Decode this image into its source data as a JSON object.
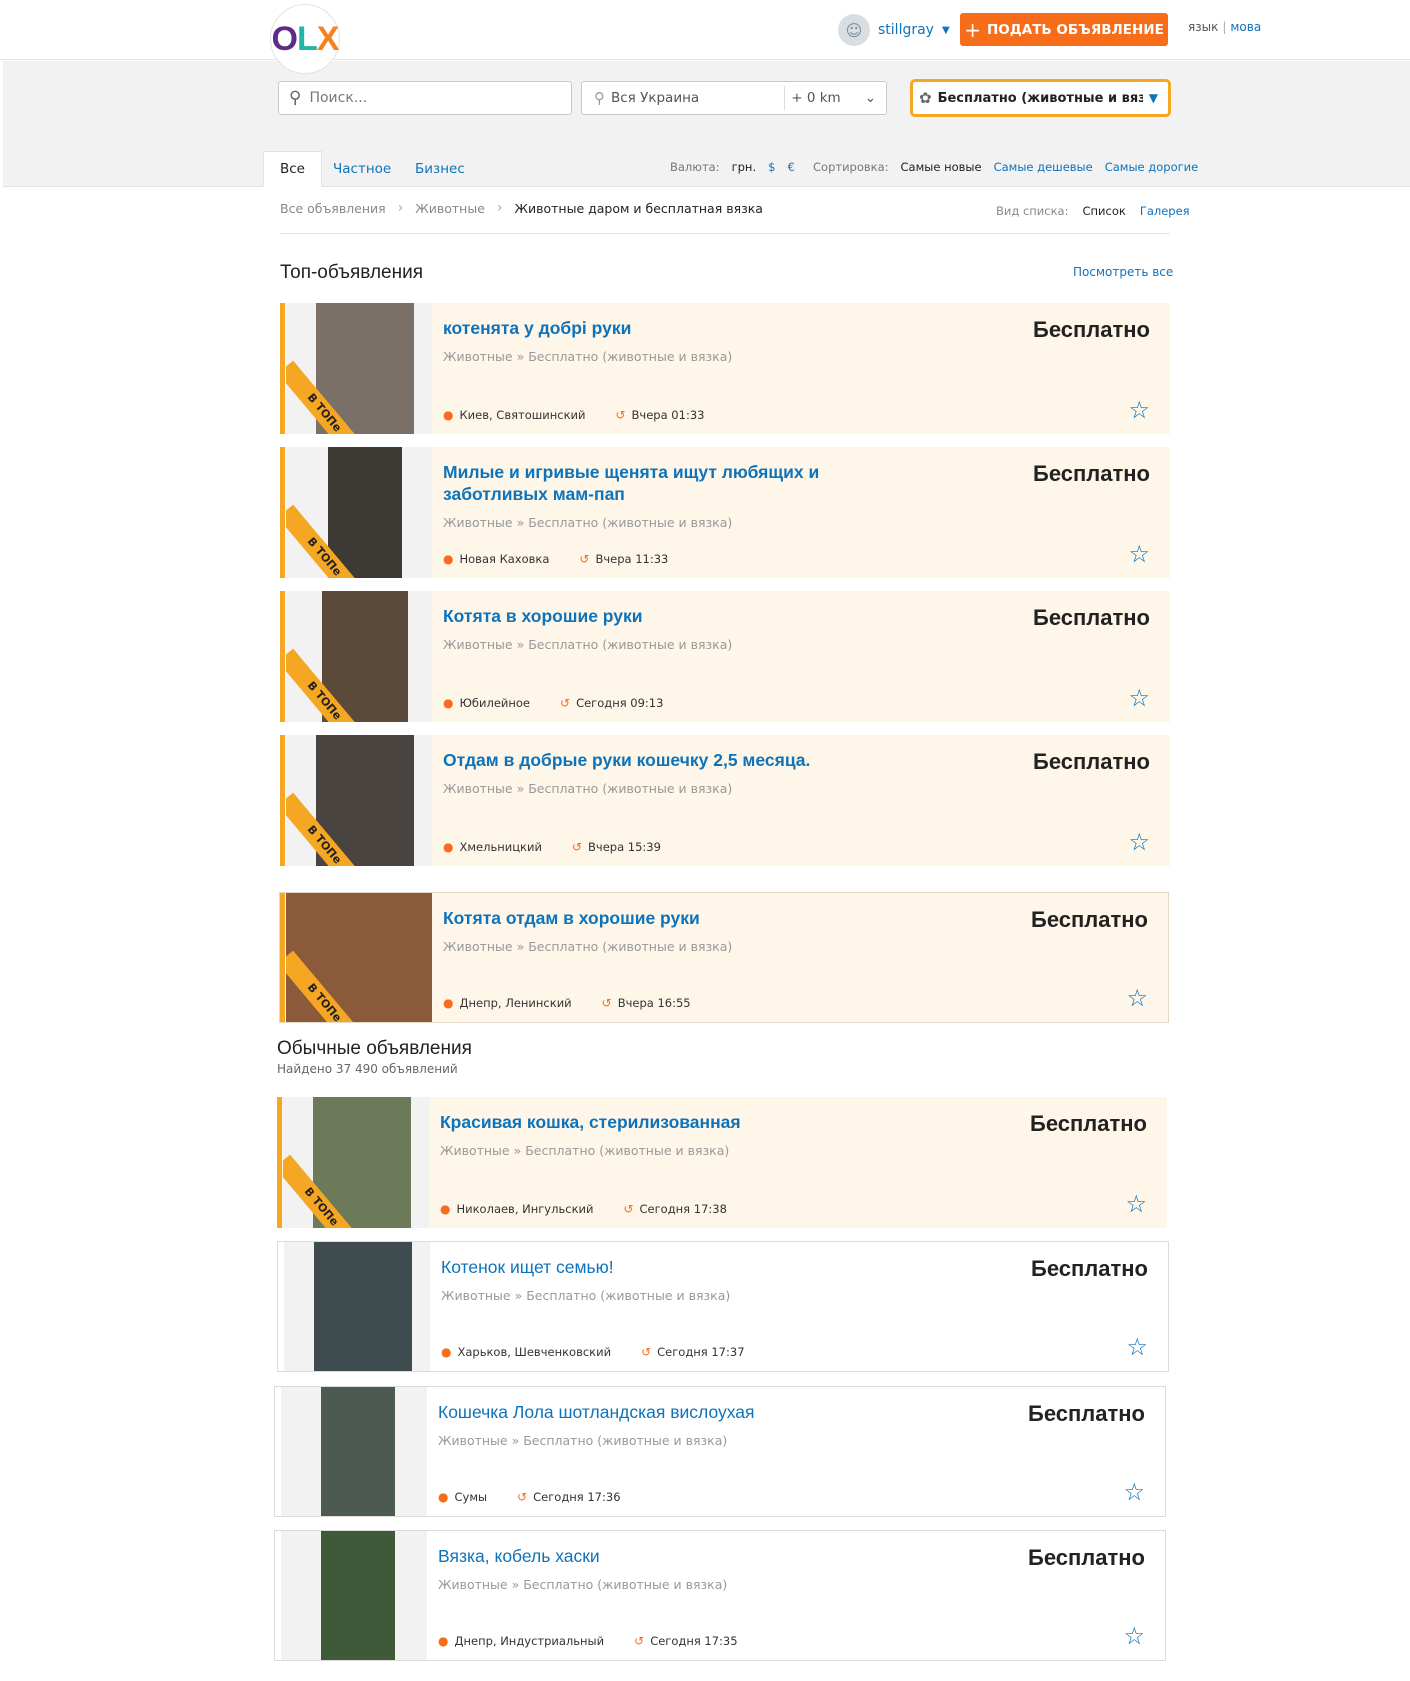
{
  "header": {
    "logo": "OLX",
    "username": "stillgray",
    "post_button": "ПОДАТЬ ОБЪЯВЛЕНИЕ",
    "lang_ru": "язык",
    "lang_sep": "|",
    "lang_ua": "мова"
  },
  "search": {
    "placeholder": "Поиск...",
    "location": "Вся Украина",
    "radius": "+ 0 km",
    "category": "Бесплатно (животные и вяз..."
  },
  "tabs": [
    "Все",
    "Частное",
    "Бизнес"
  ],
  "currency": {
    "label": "Валюта:",
    "options": [
      "грн.",
      "$",
      "€"
    ]
  },
  "sort": {
    "label": "Сортировка:",
    "options": [
      "Самые новые",
      "Самые дешевые",
      "Самые дорогие"
    ]
  },
  "breadcrumbs": [
    "Все объявления",
    "Животные",
    "Животные даром и бесплатная вязка"
  ],
  "view": {
    "label": "Вид списка:",
    "options": [
      "Список",
      "Галерея"
    ]
  },
  "top_section": {
    "title": "Топ-объявления",
    "see_all": "Посмотреть все"
  },
  "regular_section": {
    "title": "Обычные объявления",
    "found": "Найдено 37 490 объявлений"
  },
  "badge_text": "В ТОПе",
  "top_listings": [
    {
      "title": "котенята у добрі руки",
      "category": "Животные » Бесплатно (животные и вязка)",
      "location": "Киев, Святошинский",
      "time": "Вчера 01:33",
      "price": "Бесплатно",
      "photo_color": "#7a7068"
    },
    {
      "title": "Милые и игривые щенята ищут любящих и заботливых мам-пап",
      "category": "Животные » Бесплатно (животные и вязка)",
      "location": "Новая Каховка",
      "time": "Вчера 11:33",
      "price": "Бесплатно",
      "photo_color": "#3d3a33"
    },
    {
      "title": "Котята в хорошие руки",
      "category": "Животные » Бесплатно (животные и вязка)",
      "location": "Юбилейное",
      "time": "Сегодня 09:13",
      "price": "Бесплатно",
      "photo_color": "#5b4a3a"
    },
    {
      "title": "Отдам в добрые руки кошечку 2,5 месяца.",
      "category": "Животные » Бесплатно (животные и вязка)",
      "location": "Хмельницкий",
      "time": "Вчера 15:39",
      "price": "Бесплатно",
      "photo_color": "#4a4440"
    },
    {
      "title": "Котята отдам в хорошие руки",
      "category": "Животные » Бесплатно (животные и вязка)",
      "location": "Днепр, Ленинский",
      "time": "Вчера 16:55",
      "price": "Бесплатно",
      "photo_color": "#8a5a3a"
    }
  ],
  "regular_listings": [
    {
      "title": "Красивая кошка, стерилизованная",
      "category": "Животные » Бесплатно (животные и вязка)",
      "location": "Николаев, Ингульский",
      "time": "Сегодня 17:38",
      "price": "Бесплатно",
      "photo_color": "#6d7a5a"
    },
    {
      "title": "Котенок ищет семью!",
      "category": "Животные » Бесплатно (животные и вязка)",
      "location": "Харьков, Шевченковский",
      "time": "Сегодня 17:37",
      "price": "Бесплатно",
      "photo_color": "#3e4c50"
    },
    {
      "title": "Кошечка Лола шотландская вислоухая",
      "category": "Животные » Бесплатно (животные и вязка)",
      "location": "Сумы",
      "time": "Сегодня 17:36",
      "price": "Бесплатно",
      "photo_color": "#4c5a52"
    },
    {
      "title": "Вязка, кобель хаски",
      "category": "Животные » Бесплатно (животные и вязка)",
      "location": "Днепр, Индустриальный",
      "time": "Сегодня 17:35",
      "price": "Бесплатно",
      "photo_color": "#3f5a38"
    }
  ]
}
